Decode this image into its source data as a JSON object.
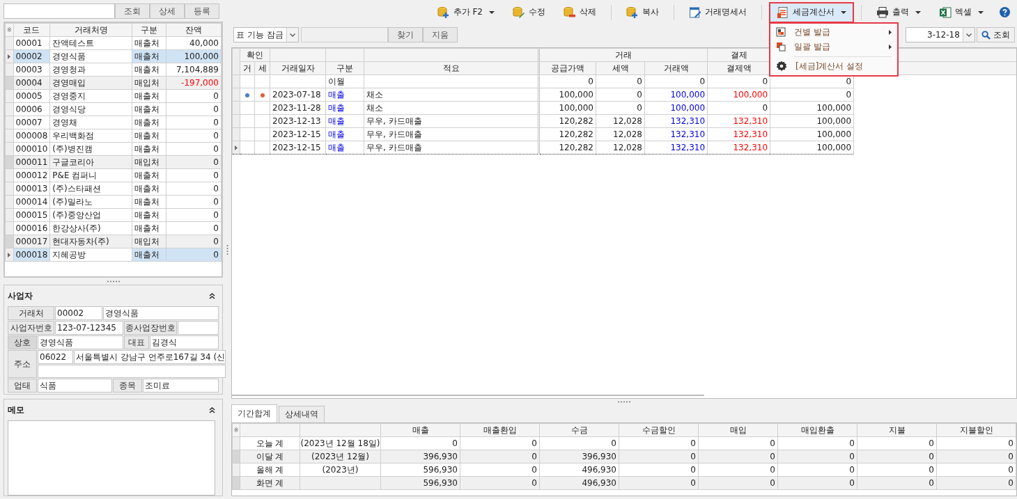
{
  "customer_search": {
    "buttons": [
      "조회",
      "상세",
      "등록"
    ]
  },
  "customer_table": {
    "corner": "※",
    "columns": [
      "코드",
      "거래처명",
      "구분",
      "잔액"
    ],
    "rows": [
      {
        "code": "00001",
        "name": "잔액테스트",
        "type": "매출처",
        "balance": "40,000",
        "selected": false,
        "shaded": false,
        "negative": false
      },
      {
        "code": "00002",
        "name": "경영식품",
        "type": "매출처",
        "balance": "100,000",
        "selected": true,
        "shaded": false,
        "negative": false
      },
      {
        "code": "00003",
        "name": "경영청과",
        "type": "매출처",
        "balance": "7,104,889",
        "selected": false,
        "shaded": false,
        "negative": false
      },
      {
        "code": "00004",
        "name": "경영매입",
        "type": "매입처",
        "balance": "-197,000",
        "selected": false,
        "shaded": true,
        "negative": true
      },
      {
        "code": "00005",
        "name": "경영중지",
        "type": "매출처",
        "balance": "0",
        "selected": false,
        "shaded": false,
        "negative": false
      },
      {
        "code": "00006",
        "name": "경영식당",
        "type": "매출처",
        "balance": "0",
        "selected": false,
        "shaded": false,
        "negative": false
      },
      {
        "code": "00007",
        "name": "경영채",
        "type": "매출처",
        "balance": "0",
        "selected": false,
        "shaded": false,
        "negative": false
      },
      {
        "code": "000008",
        "name": "우리백화점",
        "type": "매출처",
        "balance": "0",
        "selected": false,
        "shaded": false,
        "negative": false
      },
      {
        "code": "000010",
        "name": "(주)병진캠",
        "type": "매출처",
        "balance": "0",
        "selected": false,
        "shaded": false,
        "negative": false
      },
      {
        "code": "000011",
        "name": "구글코리아",
        "type": "매입처",
        "balance": "0",
        "selected": false,
        "shaded": true,
        "negative": false
      },
      {
        "code": "000012",
        "name": "P&E 컴퍼니",
        "type": "매출처",
        "balance": "0",
        "selected": false,
        "shaded": false,
        "negative": false
      },
      {
        "code": "000013",
        "name": "(주)스타패션",
        "type": "매출처",
        "balance": "0",
        "selected": false,
        "shaded": false,
        "negative": false
      },
      {
        "code": "000014",
        "name": "(주)밀라노",
        "type": "매출처",
        "balance": "0",
        "selected": false,
        "shaded": false,
        "negative": false
      },
      {
        "code": "000015",
        "name": "(주)중앙산업",
        "type": "매출처",
        "balance": "0",
        "selected": false,
        "shaded": false,
        "negative": false
      },
      {
        "code": "000016",
        "name": "한강상사(주)",
        "type": "매출처",
        "balance": "0",
        "selected": false,
        "shaded": false,
        "negative": false
      },
      {
        "code": "000017",
        "name": "현대자동차(주)",
        "type": "매입처",
        "balance": "0",
        "selected": false,
        "shaded": true,
        "negative": false
      },
      {
        "code": "000018",
        "name": "지혜공방",
        "type": "매출처",
        "balance": "0",
        "selected": true,
        "shaded": false,
        "negative": false
      }
    ]
  },
  "business": {
    "title": "사업자",
    "partner_label": "거래처",
    "partner_code": "00002",
    "partner_name": "경영식품",
    "reg_no_label": "사업자번호",
    "reg_no": "123-07-12345",
    "branch_no_label": "종사업장번호",
    "company_label": "상호",
    "company": "경영식품",
    "ceo_label": "대표",
    "ceo": "김경식",
    "address_label": "주소",
    "zip": "06022",
    "address": "서울특별시 강남구 언주로167길 34 (신",
    "business_type_label": "업태",
    "business_type": "식품",
    "item_label": "종목",
    "item": "조미료"
  },
  "memo": {
    "title": "메모"
  },
  "toolbar": [
    [
      {
        "kind": "add",
        "label": "추가 F2",
        "dropdown": true,
        "highlighted": false
      },
      {
        "kind": "edit",
        "label": "수정",
        "dropdown": false,
        "highlighted": false
      },
      {
        "kind": "delete",
        "label": "삭제",
        "dropdown": false,
        "highlighted": false
      }
    ],
    [
      {
        "kind": "copy",
        "label": "복사",
        "dropdown": false,
        "highlighted": false
      }
    ],
    [
      {
        "kind": "statement",
        "label": "거래명세서",
        "dropdown": false,
        "highlighted": false
      }
    ],
    [
      {
        "kind": "tax-invoice",
        "label": "세금계산서",
        "dropdown": true,
        "highlighted": true
      }
    ],
    [
      {
        "kind": "print",
        "label": "출력",
        "dropdown": true,
        "highlighted": false
      },
      {
        "kind": "excel",
        "label": "엑셀",
        "dropdown": true,
        "highlighted": false
      }
    ]
  ],
  "menu": {
    "groups": [
      [
        {
          "kind": "single",
          "label": "건별 발급",
          "submenu": true
        },
        {
          "kind": "batch",
          "label": "일괄 발급",
          "submenu": true
        }
      ],
      [
        {
          "kind": "settings",
          "label": "[세금]계산서 설정",
          "submenu": false
        }
      ]
    ]
  },
  "filter": {
    "lock_select": "표 기능 잠금",
    "find": "찾기",
    "clear": "지움",
    "date": "3-12-18",
    "search": "조회"
  },
  "trade_table": {
    "group_headers": [
      "확인",
      "거래",
      "결제"
    ],
    "columns": [
      "거",
      "세",
      "거래일자",
      "구분",
      "적요",
      "공급가액",
      "세액",
      "거래액",
      "결제액"
    ],
    "rows": [
      {
        "kind": "carryover",
        "confirm_trade": false,
        "confirm_tax": false,
        "date": "",
        "type": "이월",
        "memo": "",
        "supply": "0",
        "tax": "0",
        "amount": "0",
        "paid": "0",
        "settled": false,
        "balance": "0",
        "selected": false
      },
      {
        "kind": "sale",
        "confirm_trade": true,
        "confirm_tax": true,
        "date": "2023-07-18",
        "type": "매출",
        "memo": "채소",
        "supply": "100,000",
        "tax": "0",
        "amount": "100,000",
        "paid": "100,000",
        "settled": true,
        "balance": "0",
        "selected": false
      },
      {
        "kind": "sale",
        "confirm_trade": false,
        "confirm_tax": false,
        "date": "2023-11-28",
        "type": "매출",
        "memo": "채소",
        "supply": "100,000",
        "tax": "0",
        "amount": "100,000",
        "paid": "0",
        "settled": false,
        "balance": "100,000",
        "selected": false
      },
      {
        "kind": "sale",
        "confirm_trade": false,
        "confirm_tax": false,
        "date": "2023-12-13",
        "type": "매출",
        "memo": "무우, 카드매출",
        "supply": "120,282",
        "tax": "12,028",
        "amount": "132,310",
        "paid": "132,310",
        "settled": true,
        "balance": "100,000",
        "selected": false
      },
      {
        "kind": "sale",
        "confirm_trade": false,
        "confirm_tax": false,
        "date": "2023-12-15",
        "type": "매출",
        "memo": "무우, 카드매출",
        "supply": "120,282",
        "tax": "12,028",
        "amount": "132,310",
        "paid": "132,310",
        "settled": true,
        "balance": "100,000",
        "selected": false
      },
      {
        "kind": "sale",
        "confirm_trade": false,
        "confirm_tax": false,
        "date": "2023-12-15",
        "type": "매출",
        "memo": "무우, 카드매출",
        "supply": "120,282",
        "tax": "12,028",
        "amount": "132,310",
        "paid": "132,310",
        "settled": true,
        "balance": "100,000",
        "selected": true
      }
    ]
  },
  "bottom_tabs": [
    {
      "label": "기간합계",
      "selected": true
    },
    {
      "label": "상세내역",
      "selected": false
    }
  ],
  "summary_table": {
    "corner": "※",
    "columns": [
      "매출",
      "매출환입",
      "수금",
      "수금할인",
      "매입",
      "매입환출",
      "지불",
      "지불할인"
    ],
    "rows": [
      {
        "label": "오늘 계",
        "period": "(2023년 12월 18일)",
        "values": [
          "0",
          "0",
          "0",
          "0",
          "0",
          "0",
          "0",
          "0"
        ],
        "shaded": false
      },
      {
        "label": "이달 계",
        "period": "(2023년 12월)",
        "values": [
          "396,930",
          "0",
          "396,930",
          "0",
          "0",
          "0",
          "0",
          "0"
        ],
        "shaded": true
      },
      {
        "label": "올해 계",
        "period": "(2023년)",
        "values": [
          "596,930",
          "0",
          "496,930",
          "0",
          "0",
          "0",
          "0",
          "0"
        ],
        "shaded": false
      },
      {
        "label": "화면 계",
        "period": "",
        "values": [
          "596,930",
          "0",
          "496,930",
          "0",
          "0",
          "0",
          "0",
          "0"
        ],
        "shaded": true
      }
    ]
  }
}
